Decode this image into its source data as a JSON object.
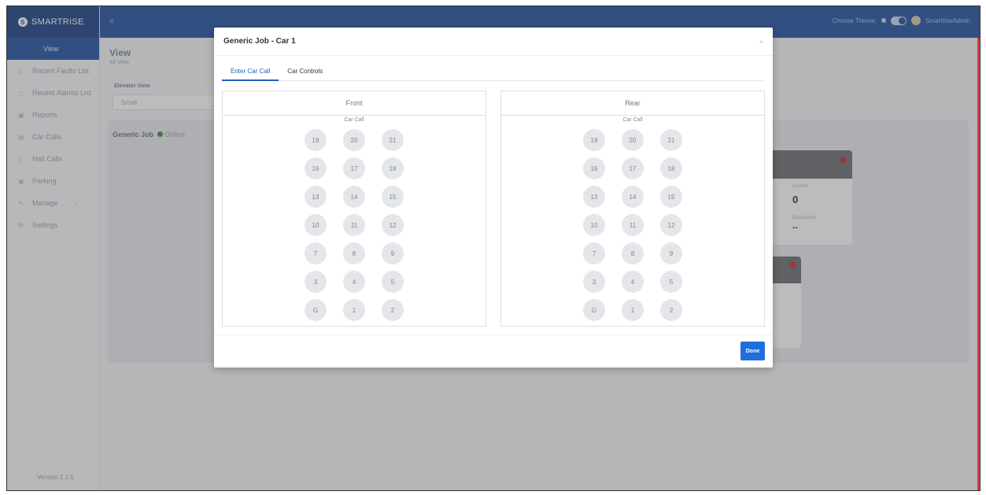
{
  "app": {
    "brand": "SMARTRISE",
    "version": "Version 1.1.5"
  },
  "topbar": {
    "theme_label": "Choose Theme:",
    "user_name": "SmartriseAdmin"
  },
  "sidebar": {
    "items": [
      {
        "label": "View",
        "icon": "eye-icon"
      },
      {
        "label": "Recent Faults List",
        "icon": "warning-icon"
      },
      {
        "label": "Recent Alarms List",
        "icon": "bell-icon"
      },
      {
        "label": "Reports",
        "icon": "report-icon"
      },
      {
        "label": "Car Calls",
        "icon": "car-call-icon"
      },
      {
        "label": "Hall Calls",
        "icon": "hall-call-icon"
      },
      {
        "label": "Parking",
        "icon": "parking-icon"
      },
      {
        "label": "Manage",
        "icon": "wrench-icon"
      },
      {
        "label": "Settings",
        "icon": "gear-icon"
      }
    ]
  },
  "main": {
    "title": "View",
    "subtitle": "All View",
    "elevator_view_label": "Elevator View",
    "elevator_view_value": "Small",
    "job_name": "Generic Job",
    "job_status": "Online",
    "card": {
      "current_label": "Current",
      "current_value": "0",
      "destination_label": "Destination",
      "destination_value": "--"
    }
  },
  "modal": {
    "title": "Generic Job - Car 1",
    "close": "×",
    "tabs": [
      {
        "label": "Enter Car Call"
      },
      {
        "label": "Car Controls"
      }
    ],
    "front": {
      "title": "Front",
      "subtitle": "Car Call"
    },
    "rear": {
      "title": "Rear",
      "subtitle": "Car Call"
    },
    "floors": [
      "19",
      "20",
      "21",
      "16",
      "17",
      "18",
      "13",
      "14",
      "15",
      "10",
      "11",
      "12",
      "7",
      "8",
      "9",
      "3",
      "4",
      "5",
      "G",
      "1",
      "2"
    ],
    "done_label": "Done"
  }
}
